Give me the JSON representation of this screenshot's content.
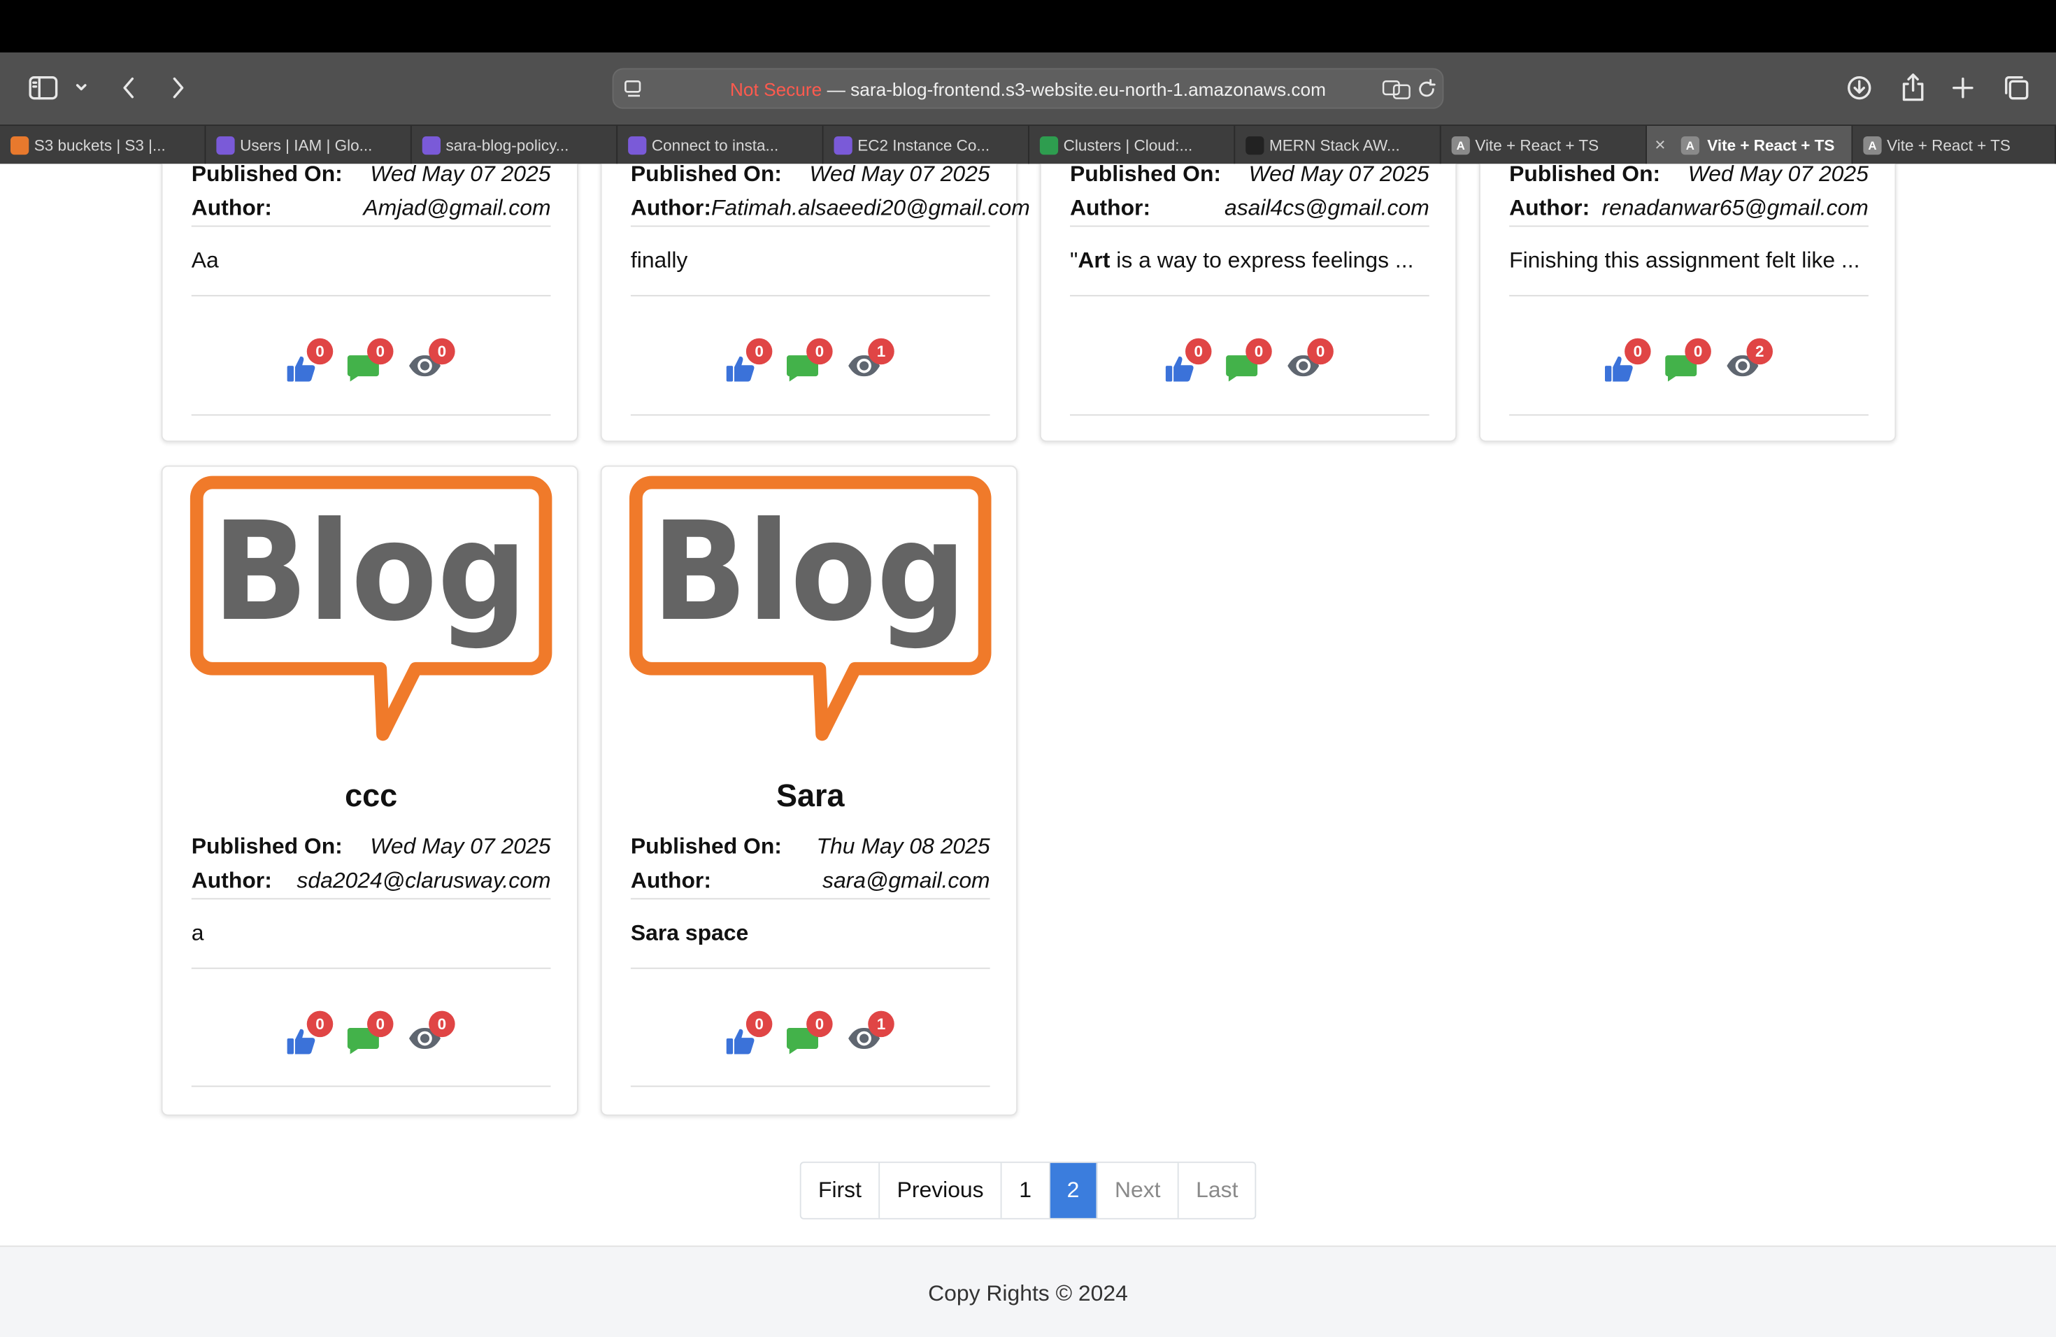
{
  "browser": {
    "address": {
      "not_secure": "Not Secure",
      "separator": " — ",
      "url": "sara-blog-frontend.s3-website.eu-north-1.amazonaws.com"
    },
    "tabs": [
      {
        "label": "S3 buckets | S3 |...",
        "icon": "aws-s3-icon",
        "color": "#e8792d"
      },
      {
        "label": "Users | IAM | Glo...",
        "icon": "aws-iam-icon",
        "color": "#7a5ad8"
      },
      {
        "label": "sara-blog-policy...",
        "icon": "aws-policy-icon",
        "color": "#7a5ad8"
      },
      {
        "label": "Connect to insta...",
        "icon": "aws-ec2-icon",
        "color": "#7a5ad8"
      },
      {
        "label": "EC2 Instance Co...",
        "icon": "aws-ec2-icon",
        "color": "#7a5ad8"
      },
      {
        "label": "Clusters | Cloud:...",
        "icon": "mongodb-leaf-icon",
        "color": "#2e9d4f"
      },
      {
        "label": "MERN Stack AW...",
        "icon": "openai-icon",
        "color": "#222222"
      },
      {
        "label": "Vite + React + TS",
        "icon": "letter-a-icon",
        "color": "#8a8a8a"
      },
      {
        "label": "Vite + React + TS",
        "icon": "letter-a-icon",
        "color": "#8a8a8a",
        "active": true
      },
      {
        "label": "Vite + React + TS",
        "icon": "letter-a-icon",
        "color": "#8a8a8a"
      }
    ],
    "tab_icon_letter": "A"
  },
  "labels": {
    "published_on": "Published On:",
    "author": "Author:"
  },
  "posts_top": [
    {
      "date": "Wed May 07 2025",
      "author": "Amjad@gmail.com",
      "excerpt": "Aa",
      "likes": "0",
      "comments": "0",
      "views": "0"
    },
    {
      "date": "Wed May 07 2025",
      "author": "Fatimah.alsaeedi20@gmail.com",
      "excerpt": "finally",
      "likes": "0",
      "comments": "0",
      "views": "1"
    },
    {
      "date": "Wed May 07 2025",
      "author": "asail4cs@gmail.com",
      "excerpt_prefix": "\"",
      "excerpt_bold": "Art",
      "excerpt_rest": " is a way to express feelings ...",
      "likes": "0",
      "comments": "0",
      "views": "0"
    },
    {
      "date": "Wed May 07 2025",
      "author": "renadanwar65@gmail.com",
      "excerpt": "Finishing this assignment felt like ...",
      "likes": "0",
      "comments": "0",
      "views": "2"
    }
  ],
  "posts_bottom": [
    {
      "image_text": "Blog",
      "title": "ccc",
      "date": "Wed May 07 2025",
      "author": "sda2024@clarusway.com",
      "excerpt": "a",
      "likes": "0",
      "comments": "0",
      "views": "0"
    },
    {
      "image_text": "Blog",
      "title": "Sara",
      "date": "Thu May 08 2025",
      "author": "sara@gmail.com",
      "excerpt": "Sara space",
      "likes": "0",
      "comments": "0",
      "views": "1"
    }
  ],
  "pagination": {
    "first": "First",
    "previous": "Previous",
    "page1": "1",
    "page2": "2",
    "next": "Next",
    "last": "Last",
    "current": 2
  },
  "footer": {
    "text": "Copy Rights © 2024"
  },
  "colors": {
    "like": "#3b72d9",
    "comment": "#43b24a",
    "view": "#5f6670",
    "badge": "#e04545",
    "blog_orange": "#f07a2a",
    "blog_gray": "#646464",
    "active_page": "#3b7ddd"
  }
}
